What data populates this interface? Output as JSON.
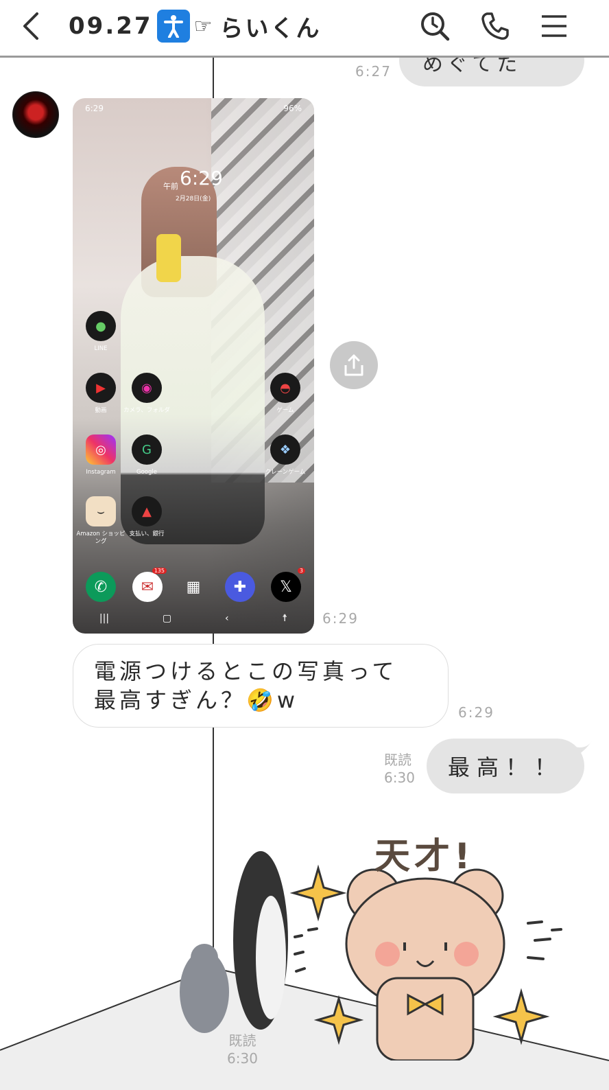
{
  "header": {
    "title_prefix": "09.27",
    "title_suffix": "らいくん",
    "accessibility_glyph": "🚹",
    "pointing_glyph": "☞"
  },
  "icons": {
    "back": "chevron-left-icon",
    "search": "search-clock-icon",
    "call": "phone-icon",
    "menu": "hamburger-menu-icon",
    "share": "share-icon"
  },
  "messages": {
    "prev_sent": {
      "text": "めぐてた",
      "time": "6:27"
    },
    "image": {
      "time": "6:29",
      "status_time": "6:29",
      "status_battery": "96%",
      "lock_ampm": "午前",
      "lock_time": "6:29",
      "lock_date": "2月28日(金)",
      "apps": [
        {
          "label": "LINE"
        },
        {
          "label": "動画"
        },
        {
          "label": "カメラ、フォルダ"
        },
        {
          "label": "ゲーム"
        },
        {
          "label": "Instagram"
        },
        {
          "label": "Google"
        },
        {
          "label": "クレーンゲーム"
        },
        {
          "label": "Amazon ショッピング"
        },
        {
          "label": "支払い、銀行"
        }
      ],
      "dock_badges": {
        "mail": "135",
        "x": "3"
      }
    },
    "received_text": {
      "line1": "電源つけるとこの写真って",
      "line2": "最高すぎん？",
      "suffix": "w",
      "emoji": "🤣",
      "time": "6:29"
    },
    "sent_text": {
      "text": "最高！！",
      "read": "既読",
      "time": "6:30"
    },
    "sticker": {
      "caption": "天才!",
      "read": "既読",
      "time": "6:30"
    }
  }
}
